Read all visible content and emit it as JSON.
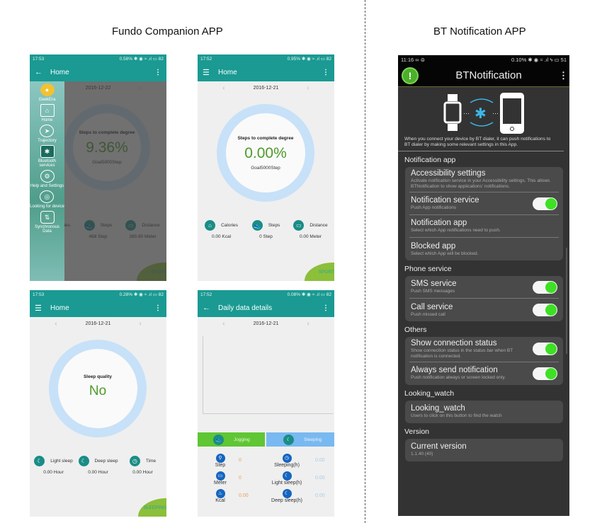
{
  "captions": {
    "left": "Fundo Companion APP",
    "right": "BT Notification APP"
  },
  "screen1": {
    "status": {
      "time": "17:53",
      "right": "0.58% ✱ ◉ ≈ .ıl ▭ 82"
    },
    "title": "Home",
    "date": "2016-12-22",
    "ring": {
      "label": "Steps to complete degree",
      "value": "9.36%",
      "goal": "Goal5000Step"
    },
    "stats": [
      {
        "label": "Calories",
        "value": ""
      },
      {
        "label": "Steps",
        "value": "468 Step"
      },
      {
        "label": "Distance",
        "value": "280.80 Meter"
      }
    ],
    "corner": "SPORT",
    "drawer": [
      {
        "label": "GeekEra",
        "icon": "avatar-icon"
      },
      {
        "label": "Home",
        "icon": "home-icon"
      },
      {
        "label": "Trajectory",
        "icon": "navigation-icon"
      },
      {
        "label": "Bluetooth services",
        "icon": "bluetooth-icon"
      },
      {
        "label": "Help and Settings",
        "icon": "gear-icon"
      },
      {
        "label": "Looking for device",
        "icon": "locate-icon"
      },
      {
        "label": "Synchronous Data",
        "icon": "sync-icon"
      }
    ]
  },
  "screen2": {
    "status": {
      "time": "17:52",
      "right": "0.95% ✱ ◉ ≈ .ıl ▭ 82"
    },
    "title": "Home",
    "date": "2016-12-21",
    "ring": {
      "label": "Steps to complete degree",
      "value": "0.00%",
      "goal": "Goal5000Step"
    },
    "stats": [
      {
        "label": "Calories",
        "value": "0.00 Kcal"
      },
      {
        "label": "Steps",
        "value": "0 Step"
      },
      {
        "label": "Distance",
        "value": "0.00 Meter"
      }
    ],
    "corner": "SPORT"
  },
  "screen3": {
    "status": {
      "time": "17:53",
      "right": "0.28% ✱ ◉ ≈ .ıl ▭ 82"
    },
    "title": "Home",
    "date": "2016-12-21",
    "ring": {
      "label": "Sleep quality",
      "value": "No"
    },
    "stats": [
      {
        "label": "Light sleep",
        "value": "0.00 Hour"
      },
      {
        "label": "Deep sleep",
        "value": "0.00 Hour"
      },
      {
        "label": "Time",
        "value": "0.00 Hour"
      }
    ],
    "corner": "SLEEPING"
  },
  "screen4": {
    "status": {
      "time": "17:52",
      "right": "0.08% ✱ ◉ ≈ .ıl ▭ 82"
    },
    "title": "Daily data details",
    "date": "2016-12-21",
    "tabs": {
      "jogging": "Jogging",
      "sleeping": "Sleeping"
    },
    "jogging": [
      {
        "label": "Step",
        "value": "0"
      },
      {
        "label": "Meter",
        "value": "0"
      },
      {
        "label": "Kcal",
        "value": "0.00"
      }
    ],
    "sleeping": [
      {
        "label": "Sleeping(h)",
        "value": "0.00"
      },
      {
        "label": "Light sleep(h)",
        "value": "0.00"
      },
      {
        "label": "Deep sleep(h)",
        "value": "0.00"
      }
    ]
  },
  "bt": {
    "status": {
      "time": "11:16 ∞ ⊜",
      "right": "0.10% ✱ ◉ ≈ .ıl ϟ ▭ 51"
    },
    "title": "BTNotification",
    "description": "When you connect your device by BT dialer, it can push notifications to BT dialer by making some relevant settings in this App.",
    "sections": [
      {
        "title": "Notification app",
        "items": [
          {
            "title": "Accessibility settings",
            "sub": "Activate notification service in your Accessibility settings. This allows BTNotification to show applications' notifications.",
            "toggle": null
          },
          {
            "title": "Notification service",
            "sub": "Push App notifications",
            "toggle": true
          },
          {
            "title": "Notification app",
            "sub": "Select which App notifications need to push.",
            "toggle": null
          },
          {
            "title": "Blocked app",
            "sub": "Select which App will be blocked.",
            "toggle": null
          }
        ]
      },
      {
        "title": "Phone service",
        "items": [
          {
            "title": "SMS service",
            "sub": "Push SMS messages",
            "toggle": true
          },
          {
            "title": "Call service",
            "sub": "Push missed call",
            "toggle": true
          }
        ]
      },
      {
        "title": "Others",
        "items": [
          {
            "title": "Show connection status",
            "sub": "Show connection status in the status bar when BT notification is connected.",
            "toggle": true
          },
          {
            "title": "Always send notification",
            "sub": "Push notification always or screen locked only.",
            "toggle": true
          }
        ]
      },
      {
        "title": "Looking_watch",
        "items": [
          {
            "title": "Looking_watch",
            "sub": "Users to click on this button to find the watch",
            "toggle": null
          }
        ]
      },
      {
        "title": "Version",
        "items": [
          {
            "title": "Current version",
            "sub": "1.1.40 (40)",
            "toggle": null
          }
        ]
      }
    ]
  }
}
